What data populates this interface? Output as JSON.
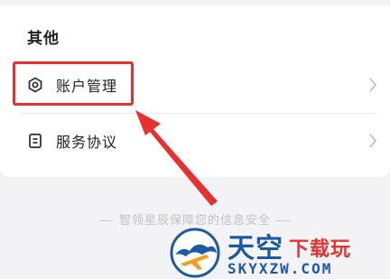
{
  "section": {
    "title": "其他"
  },
  "rows": [
    {
      "label": "账户管理",
      "icon": "hexagon-settings-icon"
    },
    {
      "label": "服务协议",
      "icon": "document-icon"
    }
  ],
  "footer": {
    "security_text": "智领星辰保障您的信息安全"
  },
  "watermark": {
    "name": "天空",
    "tagline": "下载玩",
    "domain": "SKYXZW.COM"
  },
  "colors": {
    "highlight": "#e8302f",
    "watermark_blue": "#1c5aa8"
  }
}
